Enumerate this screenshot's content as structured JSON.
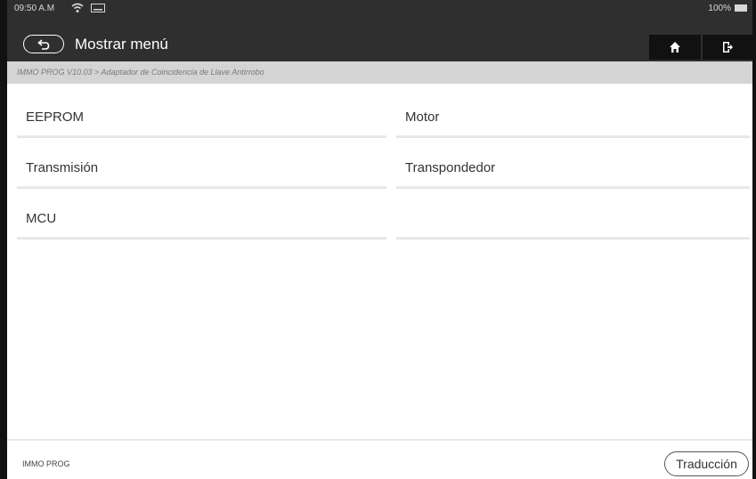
{
  "status_bar": {
    "time": "09:50 A.M",
    "battery": "100%",
    "icons": [
      "wifi-icon",
      "keyboard-icon",
      "battery-icon"
    ]
  },
  "header": {
    "title": "Mostrar menú",
    "back_icon": "back-arrow-icon",
    "home_icon": "home-icon",
    "exit_icon": "exit-icon"
  },
  "breadcrumb": "IMMO PROG V10.03 > Adaptador de Coincidencia de Llave Antirrobo",
  "menu": {
    "items": [
      {
        "label": "EEPROM"
      },
      {
        "label": "Motor"
      },
      {
        "label": "Transmisión"
      },
      {
        "label": "Transpondedor"
      },
      {
        "label": "MCU"
      },
      {
        "label": ""
      }
    ]
  },
  "footer": {
    "label": "IMMO PROG",
    "translate_button": "Traducción"
  },
  "colors": {
    "header_bg": "#2f2f2f",
    "breadcrumb_bg": "#d4d4d4",
    "button_bg": "#111111"
  }
}
